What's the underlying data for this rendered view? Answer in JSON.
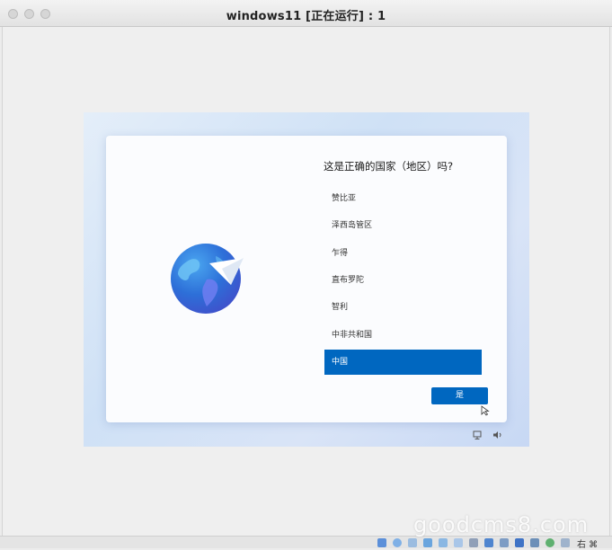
{
  "window": {
    "title": "windows11 [正在运行] : 1"
  },
  "setup": {
    "question": "这是正确的国家（地区）吗?",
    "countries": [
      {
        "label": "赞比亚",
        "selected": false
      },
      {
        "label": "泽西岛管区",
        "selected": false
      },
      {
        "label": "乍得",
        "selected": false
      },
      {
        "label": "直布罗陀",
        "selected": false
      },
      {
        "label": "智利",
        "selected": false
      },
      {
        "label": "中非共和国",
        "selected": false
      },
      {
        "label": "中国",
        "selected": true
      }
    ],
    "yes_label": "是"
  },
  "tray": {
    "network_icon": "network-icon",
    "volume_icon": "volume-icon"
  },
  "watermark": "goodcms8.com",
  "bottombar": {
    "tail_text": "右 ⌘"
  },
  "colors": {
    "accent": "#0067c0",
    "dialog_bg": "#fbfcfe"
  }
}
